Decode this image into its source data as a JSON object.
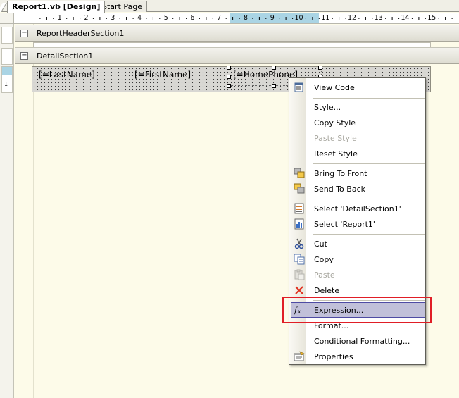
{
  "tabs": [
    {
      "label": "Report1.vb [Design]",
      "active": true
    },
    {
      "label": "Start Page",
      "active": false
    }
  ],
  "ruler": {
    "labels": [
      "1",
      "2",
      "3",
      "4",
      "5",
      "6",
      "7",
      "8",
      "9",
      "10",
      "11",
      "12",
      "13",
      "14",
      "15"
    ]
  },
  "vruler": {
    "detail_number": "1"
  },
  "sections": {
    "report_header": {
      "label": "ReportHeaderSection1",
      "toggle": "−"
    },
    "detail": {
      "label": "DetailSection1",
      "toggle": "−"
    }
  },
  "fields": {
    "last_name": "[=LastName]",
    "first_name": "[=FirstName]",
    "home_phone": "[=HomePhone]"
  },
  "context_menu": {
    "items": [
      {
        "label": "View Code",
        "icon": "view-code-icon",
        "enabled": true
      },
      {
        "label": "Style...",
        "icon": null,
        "enabled": true
      },
      {
        "label": "Copy Style",
        "icon": null,
        "enabled": true
      },
      {
        "label": "Paste Style",
        "icon": null,
        "enabled": false
      },
      {
        "label": "Reset Style",
        "icon": null,
        "enabled": true
      },
      {
        "label": "Bring To Front",
        "icon": "bring-to-front-icon",
        "enabled": true
      },
      {
        "label": "Send To Back",
        "icon": "send-to-back-icon",
        "enabled": true
      },
      {
        "label": "Select 'DetailSection1'",
        "icon": "select-section-icon",
        "enabled": true
      },
      {
        "label": "Select 'Report1'",
        "icon": "select-report-icon",
        "enabled": true
      },
      {
        "label": "Cut",
        "icon": "cut-icon",
        "enabled": true
      },
      {
        "label": "Copy",
        "icon": "copy-icon",
        "enabled": true
      },
      {
        "label": "Paste",
        "icon": "paste-icon",
        "enabled": false
      },
      {
        "label": "Delete",
        "icon": "delete-icon",
        "enabled": true
      },
      {
        "label": "Expression...",
        "icon": "fx-icon",
        "enabled": true,
        "highlighted": true
      },
      {
        "label": "Format...",
        "icon": null,
        "enabled": true
      },
      {
        "label": "Conditional Formatting...",
        "icon": null,
        "enabled": true
      },
      {
        "label": "Properties",
        "icon": "properties-icon",
        "enabled": true
      }
    ]
  },
  "colors": {
    "highlight_bg": "#c1c0d9",
    "highlight_border": "#4e4ba3",
    "annotation": "#e01e26",
    "ruler_highlight": "#aad4e4",
    "canvas_bg": "#fdfbe9"
  }
}
